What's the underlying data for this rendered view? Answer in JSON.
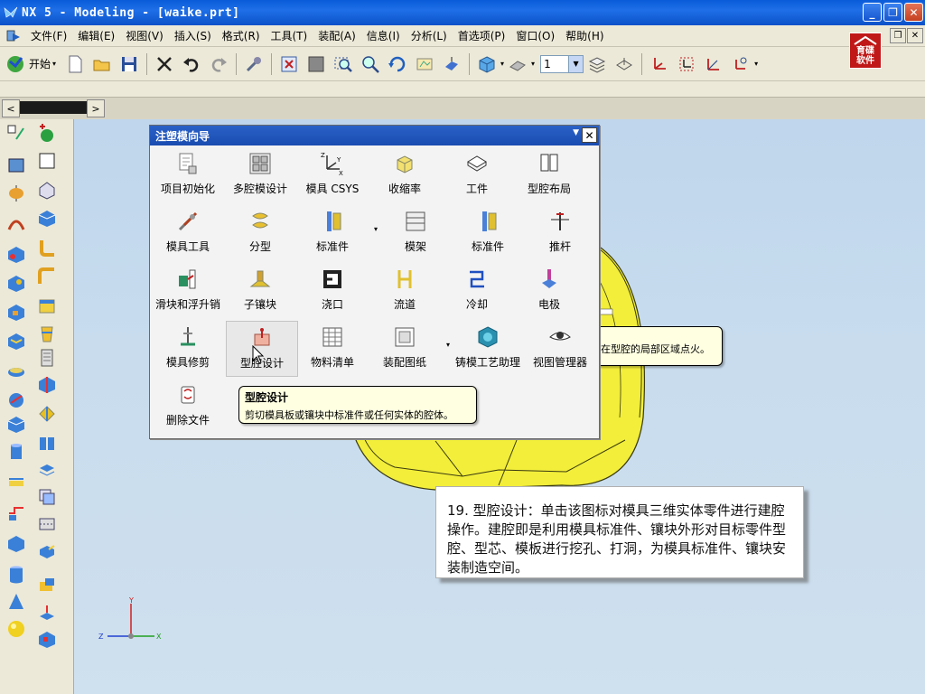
{
  "window": {
    "title": "NX 5 - Modeling - [waike.prt]"
  },
  "menu": {
    "items": [
      "文件(F)",
      "编辑(E)",
      "视图(V)",
      "插入(S)",
      "格式(R)",
      "工具(T)",
      "装配(A)",
      "信息(I)",
      "分析(L)",
      "首选项(P)",
      "窗口(O)",
      "帮助(H)"
    ]
  },
  "toolbar": {
    "start_label": "开始",
    "layer_value": "1"
  },
  "logo": {
    "text": "育碟软件"
  },
  "dialog": {
    "title": "注塑模向导",
    "tiles": [
      {
        "label": "项目初始化",
        "icon": "project-init-icon"
      },
      {
        "label": "多腔模设计",
        "icon": "multi-cavity-icon"
      },
      {
        "label": "模具 CSYS",
        "icon": "mold-csys-icon"
      },
      {
        "label": "收缩率",
        "icon": "shrinkage-icon"
      },
      {
        "label": "工件",
        "icon": "workpiece-icon"
      },
      {
        "label": "型腔布局",
        "icon": "cavity-layout-icon"
      },
      {
        "label": "模具工具",
        "icon": "mold-tools-icon"
      },
      {
        "label": "分型",
        "icon": "parting-icon"
      },
      {
        "label": "标准件",
        "icon": "standard-part-icon"
      },
      {
        "label": "模架",
        "icon": "mold-base-icon"
      },
      {
        "label": "标准件",
        "icon": "standard-part-2-icon"
      },
      {
        "label": "推杆",
        "icon": "ejector-pin-icon"
      },
      {
        "label": "滑块和浮升销",
        "icon": "slider-lifter-icon"
      },
      {
        "label": "子镶块",
        "icon": "sub-insert-icon"
      },
      {
        "label": "浇口",
        "icon": "gate-icon"
      },
      {
        "label": "流道",
        "icon": "runner-icon"
      },
      {
        "label": "冷却",
        "icon": "cooling-icon"
      },
      {
        "label": "电极",
        "icon": "electrode-icon"
      },
      {
        "label": "模具修剪",
        "icon": "mold-trim-icon"
      },
      {
        "label": "型腔设计",
        "icon": "cavity-design-icon"
      },
      {
        "label": "物料清单",
        "icon": "bom-icon"
      },
      {
        "label": "装配图纸",
        "icon": "assembly-drawing-icon"
      },
      {
        "label": "铸模工艺助理",
        "icon": "casting-process-icon"
      },
      {
        "label": "视图管理器",
        "icon": "view-manager-icon"
      },
      {
        "label": "删除文件",
        "icon": "delete-file-icon"
      }
    ]
  },
  "tooltip_main": {
    "title": "型腔设计",
    "desc": "剪切模具板或镶块中标准件或任何实体的腔体。"
  },
  "tooltip_side": {
    "text": "在型腔的局部区域点火。"
  },
  "note": {
    "text": "19. 型腔设计：单击该图标对模具三维实体零件进行建腔操作。建腔即是利用模具标准件、镶块外形对目标零件型腔、型芯、模板进行挖孔、打洞，为模具标准件、镶块安装制造空间。"
  },
  "triad": {
    "x": "X",
    "y": "Y",
    "z": "Z"
  },
  "colors": {
    "viewport": "#c8dcee",
    "part_yellow": "#f2ee3a",
    "title_blue": "#1f6fe8"
  }
}
